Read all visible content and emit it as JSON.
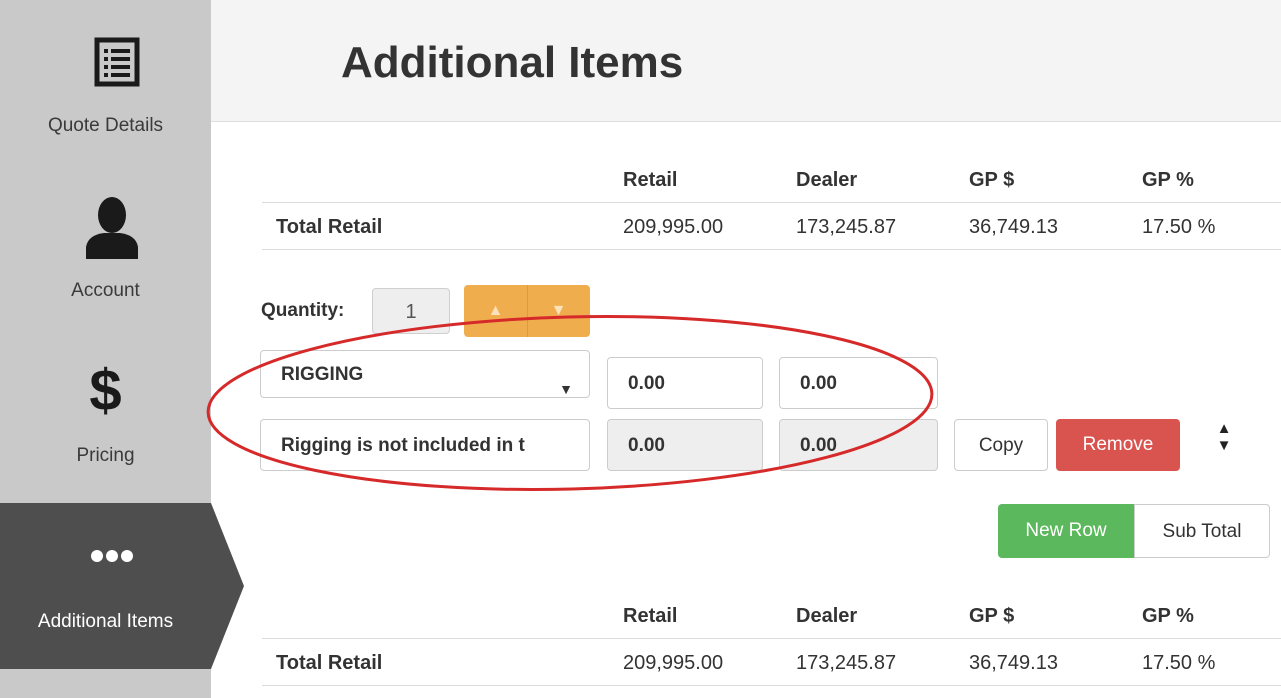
{
  "sidebar": {
    "items": [
      {
        "label": "Quote Details",
        "icon": "list-icon"
      },
      {
        "label": "Account",
        "icon": "user-icon"
      },
      {
        "label": "Pricing",
        "icon": "dollar-icon",
        "symbol": "$"
      },
      {
        "label": "Additional Items",
        "icon": "ellipsis-icon",
        "active": true
      }
    ]
  },
  "header": {
    "title": "Additional Items"
  },
  "totals_top": {
    "columns": [
      "Retail",
      "Dealer",
      "GP $",
      "GP %"
    ],
    "row": {
      "label": "Total Retail",
      "retail": "209,995.00",
      "dealer": "173,245.87",
      "gp_amount": "36,749.13",
      "gp_percent": "17.50 %"
    }
  },
  "editor": {
    "quantity_label": "Quantity:",
    "quantity_value": "1",
    "item_select": "RIGGING",
    "retail_value": "0.00",
    "dealer_value": "0.00",
    "description": "Rigging is not included in t",
    "line_retail": "0.00",
    "line_dealer": "0.00",
    "copy_label": "Copy",
    "remove_label": "Remove",
    "new_row_label": "New Row",
    "sub_total_label": "Sub Total"
  },
  "totals_bottom": {
    "columns": [
      "Retail",
      "Dealer",
      "GP $",
      "GP %"
    ],
    "row": {
      "label": "Total Retail",
      "retail": "209,995.00",
      "dealer": "173,245.87",
      "gp_amount": "36,749.13",
      "gp_percent": "17.50 %"
    }
  },
  "colors": {
    "sidebar_bg": "#c9c9c9",
    "sidebar_active": "#4e4e4e",
    "stepper": "#f0ad4e",
    "remove": "#d9534f",
    "new_row": "#5cb85c",
    "annotation": "#d62a2a"
  }
}
